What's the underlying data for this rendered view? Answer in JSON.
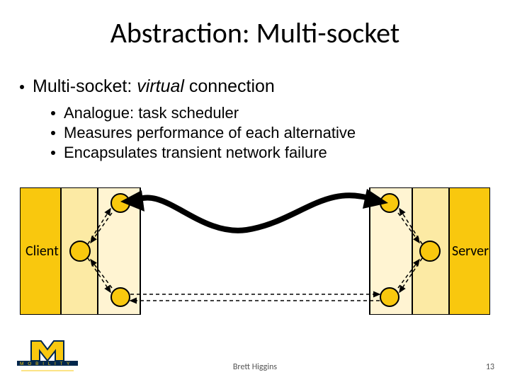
{
  "title": "Abstraction: Multi-socket",
  "bullet_main_pre": "Multi-socket: ",
  "bullet_main_em": "virtual",
  "bullet_main_post": " connection",
  "sub_bullets": [
    "Analogue: task scheduler",
    "Measures performance of each alternative",
    "Encapsulates transient network failure"
  ],
  "client_label": "Client",
  "server_label": "Server",
  "footer_name": "Brett Higgins",
  "footer_num": "13",
  "logo_text": "M O B I L I T Y",
  "colors": {
    "maize": "#f9c80e",
    "maize_light": "#fceaa4",
    "maize_pale": "#fff4d2",
    "navy": "#00274c"
  }
}
